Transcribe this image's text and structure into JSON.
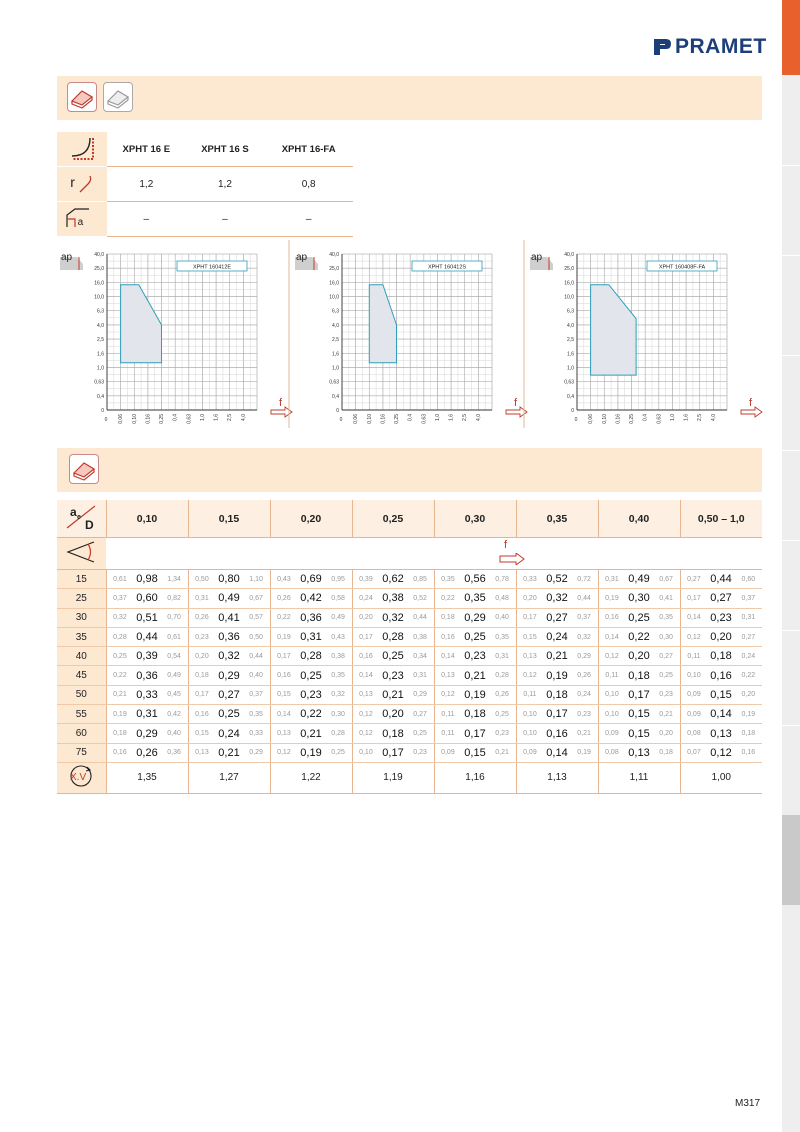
{
  "brand": "PRAMET",
  "page_number": "M317",
  "tool_table": {
    "headers": [
      "XPHT 16 E",
      "XPHT 16 S",
      "XPHT 16-FA"
    ],
    "rows": [
      {
        "symbol": "r",
        "values": [
          "1,2",
          "1,2",
          "0,8"
        ]
      },
      {
        "symbol": "a",
        "values": [
          "–",
          "–",
          "–"
        ]
      }
    ]
  },
  "chart_data": [
    {
      "type": "area",
      "title": "XPHT 160412E",
      "xlabel": "f",
      "ylabel": "ap",
      "yticks": [
        "40,0",
        "25,0",
        "16,0",
        "10,0",
        "6,3",
        "4,0",
        "2,5",
        "1,6",
        "1,0",
        "0,63",
        "0,4",
        "0"
      ],
      "xticks": [
        "0,06",
        "0,10",
        "0,16",
        "0,25",
        "0,4",
        "0,63",
        "1,0",
        "1,6",
        "2,5",
        "4,0"
      ],
      "polygon": [
        [
          0.06,
          1.2
        ],
        [
          0.06,
          15
        ],
        [
          0.12,
          15
        ],
        [
          0.25,
          4
        ],
        [
          0.25,
          1.2
        ]
      ]
    },
    {
      "type": "area",
      "title": "XPHT 160412S",
      "xlabel": "f",
      "ylabel": "ap",
      "yticks": [
        "40,0",
        "25,0",
        "16,0",
        "10,0",
        "6,3",
        "4,0",
        "2,5",
        "1,6",
        "1,0",
        "0,63",
        "0,4",
        "0"
      ],
      "xticks": [
        "0,06",
        "0,10",
        "0,16",
        "0,25",
        "0,4",
        "0,63",
        "1,0",
        "1,6",
        "2,5",
        "4,0"
      ],
      "polygon": [
        [
          0.1,
          1.2
        ],
        [
          0.1,
          15
        ],
        [
          0.16,
          15
        ],
        [
          0.25,
          4
        ],
        [
          0.25,
          1.2
        ]
      ]
    },
    {
      "type": "area",
      "title": "XPHT 160408F-FA",
      "xlabel": "f",
      "ylabel": "ap",
      "yticks": [
        "40,0",
        "25,0",
        "16,0",
        "10,0",
        "6,3",
        "4,0",
        "2,5",
        "1,6",
        "1,0",
        "0,63",
        "0,4",
        "0"
      ],
      "xticks": [
        "0,06",
        "0,10",
        "0,16",
        "0,25",
        "0,4",
        "0,63",
        "1,0",
        "1,6",
        "2,5",
        "4,0"
      ],
      "polygon": [
        [
          0.06,
          0.8
        ],
        [
          0.06,
          15
        ],
        [
          0.12,
          15
        ],
        [
          0.3,
          5
        ],
        [
          0.3,
          0.8
        ]
      ]
    }
  ],
  "cut_table": {
    "ae_label": "a",
    "ae_sub": "e",
    "d_label": "D",
    "f_label": "f",
    "groups": [
      "0,10",
      "0,15",
      "0,20",
      "0,25",
      "0,30",
      "0,35",
      "0,40",
      "0,50 – 1,0"
    ],
    "rows": [
      {
        "k": "15",
        "v": [
          [
            "0,61",
            "0,98",
            "1,34"
          ],
          [
            "0,50",
            "0,80",
            "1,10"
          ],
          [
            "0,43",
            "0,69",
            "0,95"
          ],
          [
            "0,39",
            "0,62",
            "0,85"
          ],
          [
            "0,35",
            "0,56",
            "0,78"
          ],
          [
            "0,33",
            "0,52",
            "0,72"
          ],
          [
            "0,31",
            "0,49",
            "0,67"
          ],
          [
            "0,27",
            "0,44",
            "0,60"
          ]
        ]
      },
      {
        "k": "25",
        "v": [
          [
            "0,37",
            "0,60",
            "0,82"
          ],
          [
            "0,31",
            "0,49",
            "0,67"
          ],
          [
            "0,26",
            "0,42",
            "0,58"
          ],
          [
            "0,24",
            "0,38",
            "0,52"
          ],
          [
            "0,22",
            "0,35",
            "0,48"
          ],
          [
            "0,20",
            "0,32",
            "0,44"
          ],
          [
            "0,19",
            "0,30",
            "0,41"
          ],
          [
            "0,17",
            "0,27",
            "0,37"
          ]
        ]
      },
      {
        "k": "30",
        "v": [
          [
            "0,32",
            "0,51",
            "0,70"
          ],
          [
            "0,26",
            "0,41",
            "0,57"
          ],
          [
            "0,22",
            "0,36",
            "0,49"
          ],
          [
            "0,20",
            "0,32",
            "0,44"
          ],
          [
            "0,18",
            "0,29",
            "0,40"
          ],
          [
            "0,17",
            "0,27",
            "0,37"
          ],
          [
            "0,16",
            "0,25",
            "0,35"
          ],
          [
            "0,14",
            "0,23",
            "0,31"
          ]
        ]
      },
      {
        "k": "35",
        "v": [
          [
            "0,28",
            "0,44",
            "0,61"
          ],
          [
            "0,23",
            "0,36",
            "0,50"
          ],
          [
            "0,19",
            "0,31",
            "0,43"
          ],
          [
            "0,17",
            "0,28",
            "0,38"
          ],
          [
            "0,16",
            "0,25",
            "0,35"
          ],
          [
            "0,15",
            "0,24",
            "0,32"
          ],
          [
            "0,14",
            "0,22",
            "0,30"
          ],
          [
            "0,12",
            "0,20",
            "0,27"
          ]
        ]
      },
      {
        "k": "40",
        "v": [
          [
            "0,25",
            "0,39",
            "0,54"
          ],
          [
            "0,20",
            "0,32",
            "0,44"
          ],
          [
            "0,17",
            "0,28",
            "0,38"
          ],
          [
            "0,16",
            "0,25",
            "0,34"
          ],
          [
            "0,14",
            "0,23",
            "0,31"
          ],
          [
            "0,13",
            "0,21",
            "0,29"
          ],
          [
            "0,12",
            "0,20",
            "0,27"
          ],
          [
            "0,11",
            "0,18",
            "0,24"
          ]
        ]
      },
      {
        "k": "45",
        "v": [
          [
            "0,22",
            "0,36",
            "0,49"
          ],
          [
            "0,18",
            "0,29",
            "0,40"
          ],
          [
            "0,16",
            "0,25",
            "0,35"
          ],
          [
            "0,14",
            "0,23",
            "0,31"
          ],
          [
            "0,13",
            "0,21",
            "0,28"
          ],
          [
            "0,12",
            "0,19",
            "0,26"
          ],
          [
            "0,11",
            "0,18",
            "0,25"
          ],
          [
            "0,10",
            "0,16",
            "0,22"
          ]
        ]
      },
      {
        "k": "50",
        "v": [
          [
            "0,21",
            "0,33",
            "0,45"
          ],
          [
            "0,17",
            "0,27",
            "0,37"
          ],
          [
            "0,15",
            "0,23",
            "0,32"
          ],
          [
            "0,13",
            "0,21",
            "0,29"
          ],
          [
            "0,12",
            "0,19",
            "0,26"
          ],
          [
            "0,11",
            "0,18",
            "0,24"
          ],
          [
            "0,10",
            "0,17",
            "0,23"
          ],
          [
            "0,09",
            "0,15",
            "0,20"
          ]
        ]
      },
      {
        "k": "55",
        "v": [
          [
            "0,19",
            "0,31",
            "0,42"
          ],
          [
            "0,16",
            "0,25",
            "0,35"
          ],
          [
            "0,14",
            "0,22",
            "0,30"
          ],
          [
            "0,12",
            "0,20",
            "0,27"
          ],
          [
            "0,11",
            "0,18",
            "0,25"
          ],
          [
            "0,10",
            "0,17",
            "0,23"
          ],
          [
            "0,10",
            "0,15",
            "0,21"
          ],
          [
            "0,09",
            "0,14",
            "0,19"
          ]
        ]
      },
      {
        "k": "60",
        "v": [
          [
            "0,18",
            "0,29",
            "0,40"
          ],
          [
            "0,15",
            "0,24",
            "0,33"
          ],
          [
            "0,13",
            "0,21",
            "0,28"
          ],
          [
            "0,12",
            "0,18",
            "0,25"
          ],
          [
            "0,11",
            "0,17",
            "0,23"
          ],
          [
            "0,10",
            "0,16",
            "0,21"
          ],
          [
            "0,09",
            "0,15",
            "0,20"
          ],
          [
            "0,08",
            "0,13",
            "0,18"
          ]
        ]
      },
      {
        "k": "75",
        "v": [
          [
            "0,16",
            "0,26",
            "0,36"
          ],
          [
            "0,13",
            "0,21",
            "0,29"
          ],
          [
            "0,12",
            "0,19",
            "0,25"
          ],
          [
            "0,10",
            "0,17",
            "0,23"
          ],
          [
            "0,09",
            "0,15",
            "0,21"
          ],
          [
            "0,09",
            "0,14",
            "0,19"
          ],
          [
            "0,08",
            "0,13",
            "0,18"
          ],
          [
            "0,07",
            "0,12",
            "0,16"
          ]
        ]
      }
    ],
    "xv_label": "X.V",
    "xv": [
      "1,35",
      "1,27",
      "1,22",
      "1,19",
      "1,16",
      "1,13",
      "1,11",
      "1,00"
    ]
  }
}
